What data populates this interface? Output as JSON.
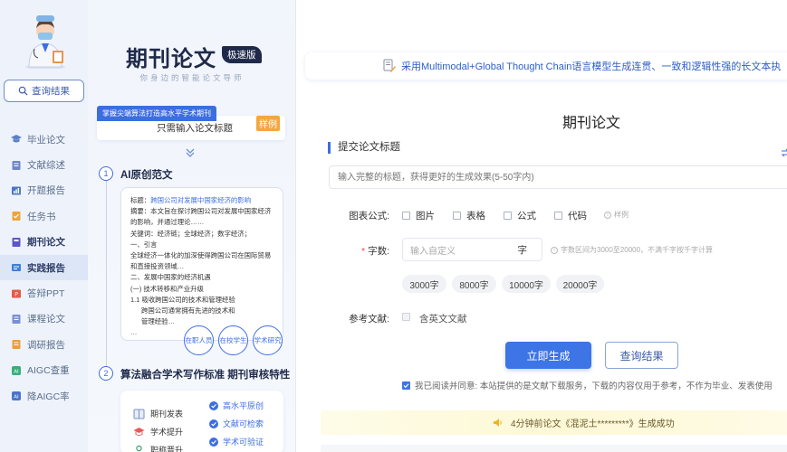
{
  "sidebar": {
    "query_button": "查询结果",
    "items": [
      {
        "label": "毕业论文",
        "icon": "graduation-cap-icon"
      },
      {
        "label": "文献综述",
        "icon": "document-icon"
      },
      {
        "label": "开题报告",
        "icon": "report-icon"
      },
      {
        "label": "任务书",
        "icon": "task-icon"
      },
      {
        "label": "期刊论文",
        "icon": "journal-icon"
      },
      {
        "label": "实践报告",
        "icon": "practice-icon"
      },
      {
        "label": "答辩PPT",
        "icon": "ppt-icon"
      },
      {
        "label": "课程论文",
        "icon": "course-icon"
      },
      {
        "label": "调研报告",
        "icon": "survey-icon"
      },
      {
        "label": "AIGC查重",
        "icon": "aigc-check-icon"
      },
      {
        "label": "降AIGC率",
        "icon": "aigc-reduce-icon"
      }
    ]
  },
  "promo": {
    "title": "期刊论文",
    "edition": "极速版",
    "tagline": "你身边的智能论文导师",
    "ribbon": "掌握尖端算法打造高水平学术期刊",
    "card_text": "只需输入论文标题",
    "sample_tag": "样例",
    "step1_num": "1",
    "step1_title": "AI原创范文",
    "paper": {
      "title_label": "标题：",
      "title_value": "跨国公司对发展中国家经济的影响",
      "abstract": "摘要：本文旨在探讨跨国公司对发展中国家经济的影响，并通过理论……",
      "keywords": "关键词：经济链；全球经济；数字经济；",
      "sec1": "一、引言",
      "sec1_text": "全球经济一体化的加深使得跨国公司在国际贸易和直接投资领域…",
      "sec2": "二、发展中国家的经济机遇",
      "sub1": "(一) 技术转移和产业升级",
      "sub2": "1.1 吸收跨国公司的技术和管理经验",
      "sub2_text": "跨国公司通常拥有先进的技术和管理经验…",
      "ellipsis": "…"
    },
    "bubbles": [
      "在职人员",
      "在校学生",
      "学术研究"
    ],
    "step2_num": "2",
    "step2_title": "算法融合学术写作标准 期刊审核特性",
    "features_left": [
      "期刊发表",
      "学术提升",
      "职称晋升"
    ],
    "features_right": [
      "高水平原创",
      "文献可检索",
      "学术可验证"
    ]
  },
  "main": {
    "banner": "采用Multimodal+Global Thought Chain语言模型生成连贯、一致和逻辑性强的长文本执",
    "title": "期刊论文",
    "section_title": "提交论文标题",
    "title_placeholder": "输入完整的标题，获得更好的生成效果(5-50字内)",
    "chart_formula_label": "图表公式:",
    "options": [
      "图片",
      "表格",
      "公式",
      "代码"
    ],
    "options_hint": "样例",
    "wordcount_label": "字数:",
    "wordcount_placeholder": "输入自定义",
    "wordcount_unit": "字",
    "wordcount_hint": "字数区间为3000至20000，不满千字按千字计算",
    "chips": [
      "3000字",
      "8000字",
      "10000字",
      "20000字"
    ],
    "reference_label": "参考文献:",
    "reference_option": "含英文文献",
    "generate_button": "立即生成",
    "query_button": "查询结果",
    "agreement": "我已阅读并同意: 本站提供的是文献下载服务，下载的内容仅用于参考，不作为毕业、发表使用",
    "notice": "4分钟前论文《混泥土*********》生成成功"
  },
  "colors": {
    "accent": "#3d74e6",
    "sidebar_bg": "#eef3fb",
    "sample_tag": "#f4a640",
    "notice_bg": "#fdf8d6"
  }
}
